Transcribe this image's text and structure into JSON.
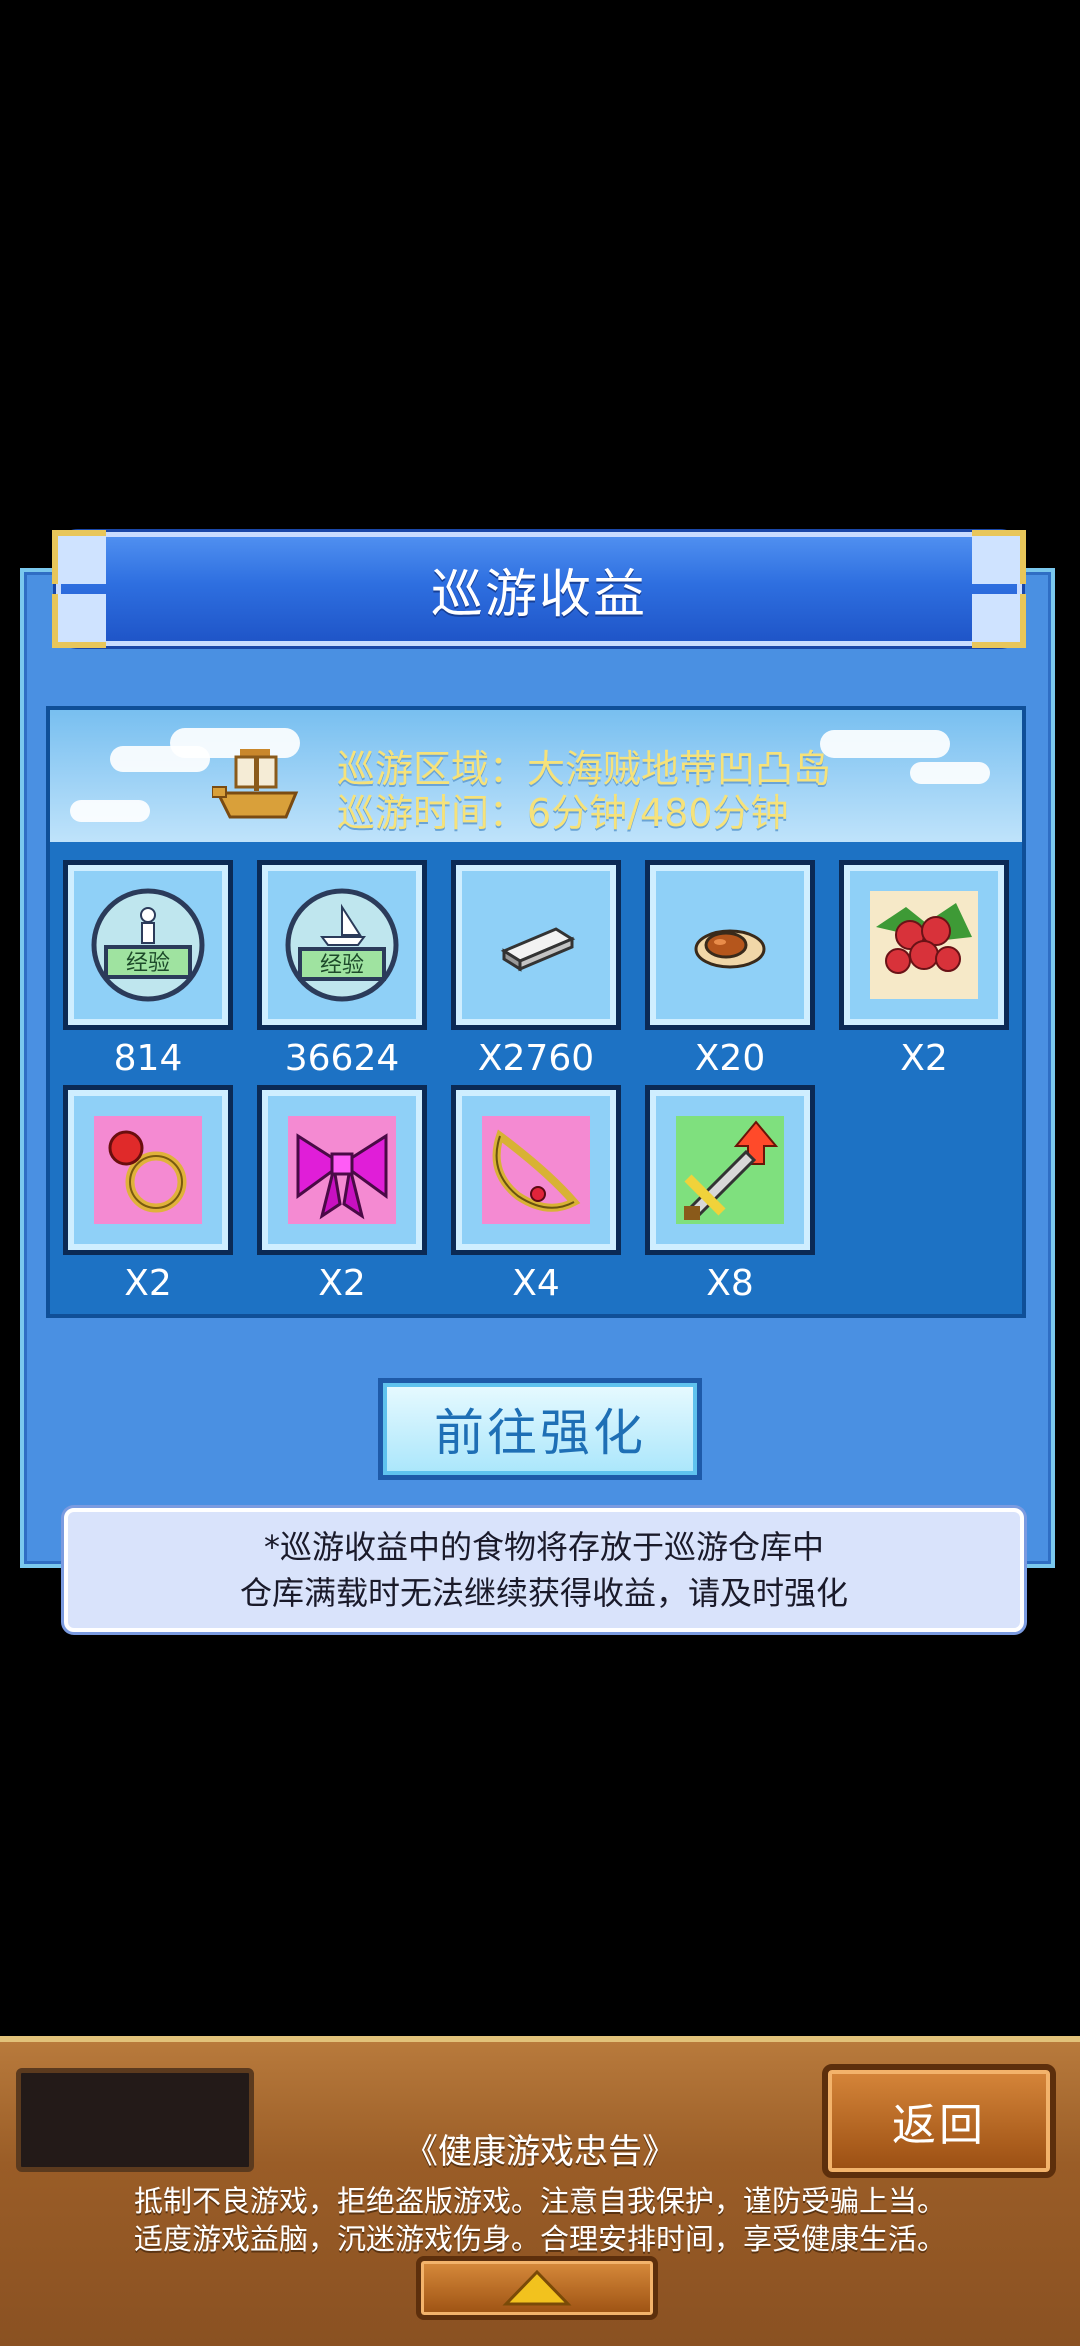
{
  "dialog": {
    "title": "巡游收益",
    "cruise_area": "巡游区域：大海贼地带凹凸岛",
    "cruise_time": "巡游时间：6分钟/480分钟"
  },
  "items": [
    {
      "icon": "exp-person-icon",
      "count": "814"
    },
    {
      "icon": "exp-ship-icon",
      "count": "36624"
    },
    {
      "icon": "silver-bar-icon",
      "count": "X2760"
    },
    {
      "icon": "cooked-meat-icon",
      "count": "X20"
    },
    {
      "icon": "red-berries-icon",
      "count": "X2"
    },
    {
      "icon": "ruby-ring-icon",
      "count": "X2"
    },
    {
      "icon": "pink-bow-icon",
      "count": "X2"
    },
    {
      "icon": "gold-necklace-icon",
      "count": "X4"
    },
    {
      "icon": "sword-upgrade-icon",
      "count": "X8"
    }
  ],
  "exp_label": "经验",
  "upgrade_button": "前往强化",
  "note": {
    "line1": "*巡游收益中的食物将存放于巡游仓库中",
    "line2": "仓库满载时无法继续获得收益，请及时强化"
  },
  "footer": {
    "back_button": "返回",
    "advice_title": "《健康游戏忠告》",
    "advice_line1": "抵制不良游戏，拒绝盗版游戏。注意自我保护，谨防受骗上当。",
    "advice_line2": "适度游戏益脑，沉迷游戏伤身。合理安排时间，享受健康生活。"
  },
  "colors": {
    "panel_blue": "#4a90e2",
    "title_blue": "#2e6fe0",
    "info_text": "#f6e27a",
    "wood": "#9a5d27"
  }
}
